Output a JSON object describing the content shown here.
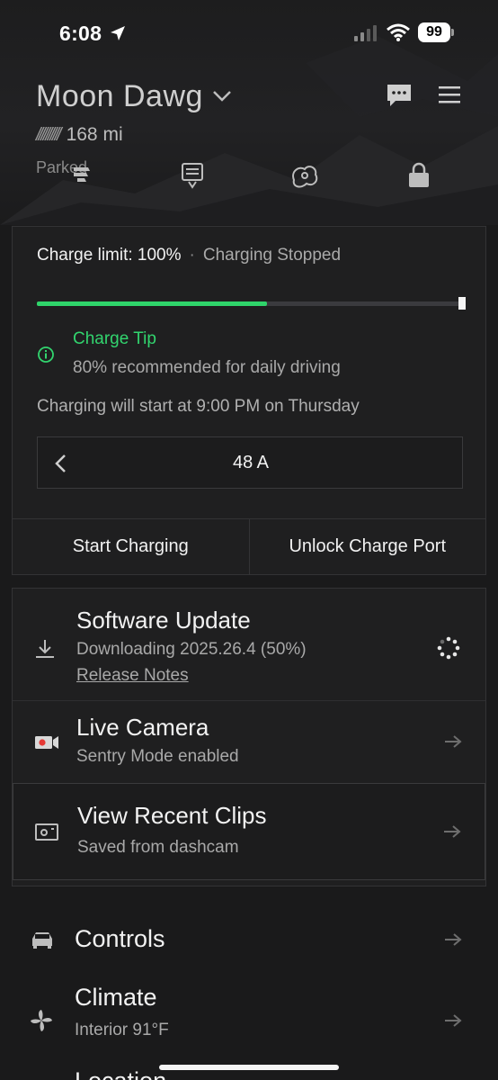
{
  "status_bar": {
    "time": "6:08",
    "battery": "99"
  },
  "vehicle": {
    "name": "Moon Dawg",
    "range_bars": "//////////",
    "range": "168 mi",
    "state": "Parked"
  },
  "charging": {
    "limit_label": "Charge limit: 100%",
    "separator": "·",
    "state": "Charging Stopped",
    "level": 0.54,
    "tip_title": "Charge Tip",
    "tip_text": "80% recommended for daily driving",
    "schedule": "Charging will start at 9:00 PM on Thursday",
    "amps": "48 A",
    "start_label": "Start Charging",
    "unlock_label": "Unlock Charge Port",
    "accent": "#2fd46a"
  },
  "cards": [
    {
      "title": "Software Update",
      "subtitle": "Downloading 2025.26.4 (50%)",
      "link": "Release Notes"
    },
    {
      "title": "Live Camera",
      "subtitle": "Sentry Mode enabled"
    },
    {
      "title": "View Recent Clips",
      "subtitle": "Saved from dashcam"
    }
  ],
  "menu": [
    {
      "title": "Controls"
    },
    {
      "title": "Climate",
      "subtitle": "Interior 91°F"
    },
    {
      "title": "Location"
    }
  ]
}
